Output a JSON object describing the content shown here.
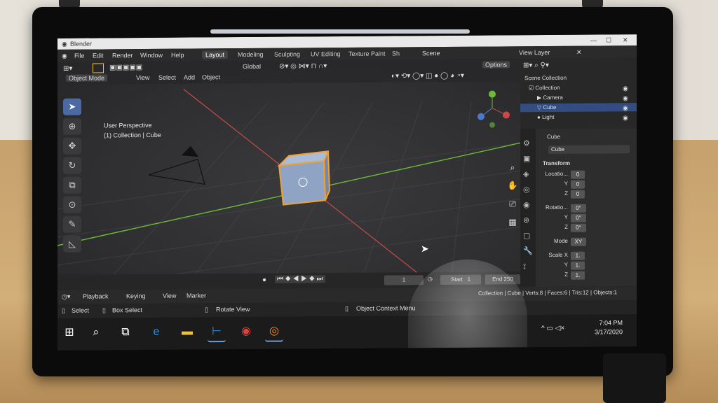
{
  "window": {
    "title": "Blender"
  },
  "menu": {
    "items": [
      "File",
      "Edit",
      "Render",
      "Window",
      "Help"
    ]
  },
  "workspace_tabs": [
    "Layout",
    "Modeling",
    "Sculpting",
    "UV Editing",
    "Texture Paint",
    "Sh"
  ],
  "scene": {
    "label": "Scene",
    "view_layer": "View Layer"
  },
  "header": {
    "mode": "Object Mode",
    "menus": [
      "View",
      "Select",
      "Add",
      "Object"
    ],
    "transform_orientation": "Global",
    "options": "Options"
  },
  "viewport": {
    "perspective": "User Perspective",
    "collection_info": "(1) Collection | Cube"
  },
  "outliner": {
    "root": "Scene Collection",
    "items": [
      {
        "label": "Collection"
      },
      {
        "label": "Camera"
      },
      {
        "label": "Cube"
      },
      {
        "label": "Light"
      }
    ]
  },
  "properties": {
    "object_name": "Cube",
    "data_name": "Cube",
    "section": "Transform",
    "location": {
      "label": "Locatio...",
      "x": "0",
      "y": "0",
      "z": "0"
    },
    "rotation": {
      "label": "Rotatio...",
      "x": "0°",
      "y": "0°",
      "z": "0°"
    },
    "mode": {
      "label": "Mode",
      "value": "XY"
    },
    "scale": {
      "label": "Scale X",
      "x": "1.",
      "y": "1.",
      "z": "1."
    },
    "axes": [
      "X",
      "Y",
      "Z"
    ]
  },
  "timeline": {
    "frame": "1",
    "start_label": "Start",
    "start": "1",
    "end_label": "End",
    "end": "250",
    "menus": [
      "Playback",
      "Keying",
      "View",
      "Marker"
    ]
  },
  "status": {
    "select": "Select",
    "box_select": "Box Select",
    "rotate_view": "Rotate View",
    "context_menu": "Object Context Menu",
    "info": "Collection | Cube | Verts:8 | Faces:6 | Tris:12 | Objects:1"
  },
  "taskbar": {
    "time": "7:04 PM",
    "date": "3/17/2020"
  },
  "colors": {
    "accent": "#4b6aa3",
    "selection": "#f0a030",
    "x_axis": "#c84a4a",
    "y_axis": "#6cbc3a"
  }
}
